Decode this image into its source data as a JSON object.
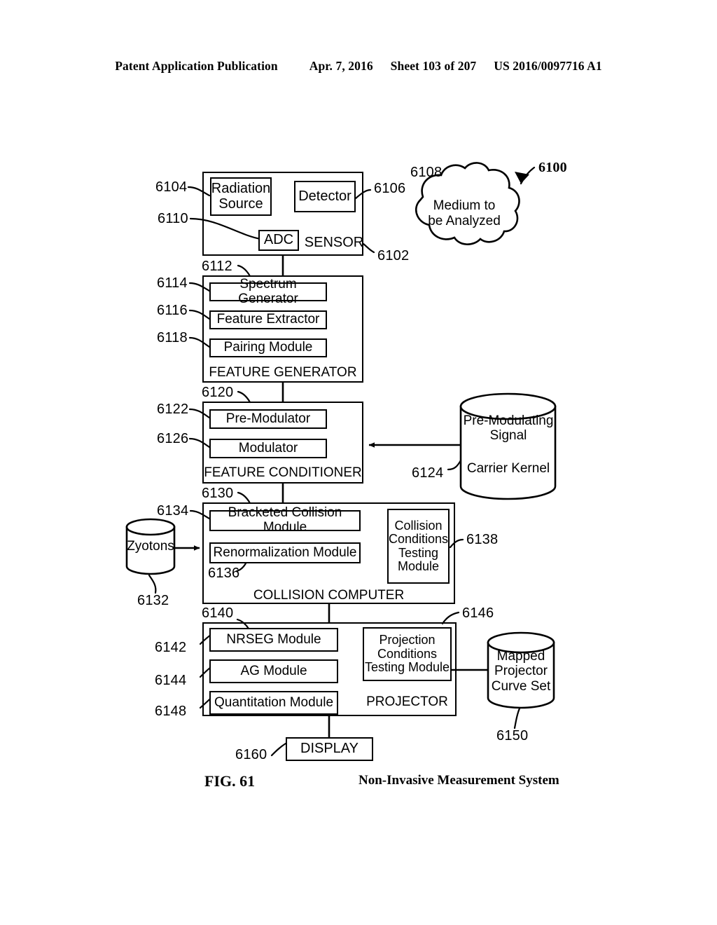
{
  "header": {
    "publication": "Patent Application Publication",
    "date": "Apr. 7, 2016",
    "sheet": "Sheet 103 of 207",
    "patent_number": "US 2016/0097716 A1"
  },
  "figure": {
    "number": "FIG. 61",
    "caption": "Non-Invasive Measurement System",
    "system_ref": "6100"
  },
  "sensor": {
    "title": "SENSOR",
    "ref": "6102",
    "ref_label": "6112",
    "radiation_source": {
      "label": "Radiation\nSource",
      "ref": "6104"
    },
    "detector": {
      "label": "Detector",
      "ref": "6106"
    },
    "adc": {
      "label": "ADC",
      "ref": "6110"
    }
  },
  "medium": {
    "label": "Medium to\nbe Analyzed",
    "ref": "6108"
  },
  "feature_generator": {
    "title": "FEATURE GENERATOR",
    "ref": "6112",
    "out_ref": "6120",
    "modules": [
      {
        "label": "Spectrum Generator",
        "ref": "6114"
      },
      {
        "label": "Feature Extractor",
        "ref": "6116"
      },
      {
        "label": "Pairing Module",
        "ref": "6118"
      }
    ]
  },
  "feature_conditioner": {
    "title": "FEATURE CONDITIONER",
    "ref": "6120",
    "out_ref": "6130",
    "modules": [
      {
        "label": "Pre-Modulator",
        "ref": "6122"
      },
      {
        "label": "Modulator",
        "ref": "6126"
      }
    ]
  },
  "premod_store": {
    "line1": "Pre-Modulating\nSignal",
    "line2": "Carrier Kernel",
    "ref": "6124"
  },
  "collision_computer": {
    "title": "COLLISION COMPUTER",
    "ref": "6130",
    "out_ref": "6140",
    "modules": [
      {
        "label": "Bracketed Collision Module",
        "ref": "6134"
      },
      {
        "label": "Renormalization Module",
        "ref": "6136"
      }
    ],
    "testing_module": {
      "label": "Collision\nConditions\nTesting\nModule",
      "ref": "6138"
    }
  },
  "zyotons_store": {
    "label": "Zyotons",
    "ref": "6132"
  },
  "projector": {
    "title": "PROJECTOR",
    "ref": "6140",
    "modules": [
      {
        "label": "NRSEG Module",
        "ref": "6142"
      },
      {
        "label": "AG Module",
        "ref": "6144"
      },
      {
        "label": "Quantitation Module",
        "ref": "6148"
      }
    ],
    "testing_module": {
      "label": "Projection\nConditions\nTesting Module",
      "ref": "6146"
    }
  },
  "curve_store": {
    "label": "Mapped\nProjector\nCurve Set",
    "ref": "6150"
  },
  "display": {
    "label": "DISPLAY",
    "ref": "6160"
  },
  "style": {
    "line_color": "#000000",
    "background": "#ffffff"
  }
}
